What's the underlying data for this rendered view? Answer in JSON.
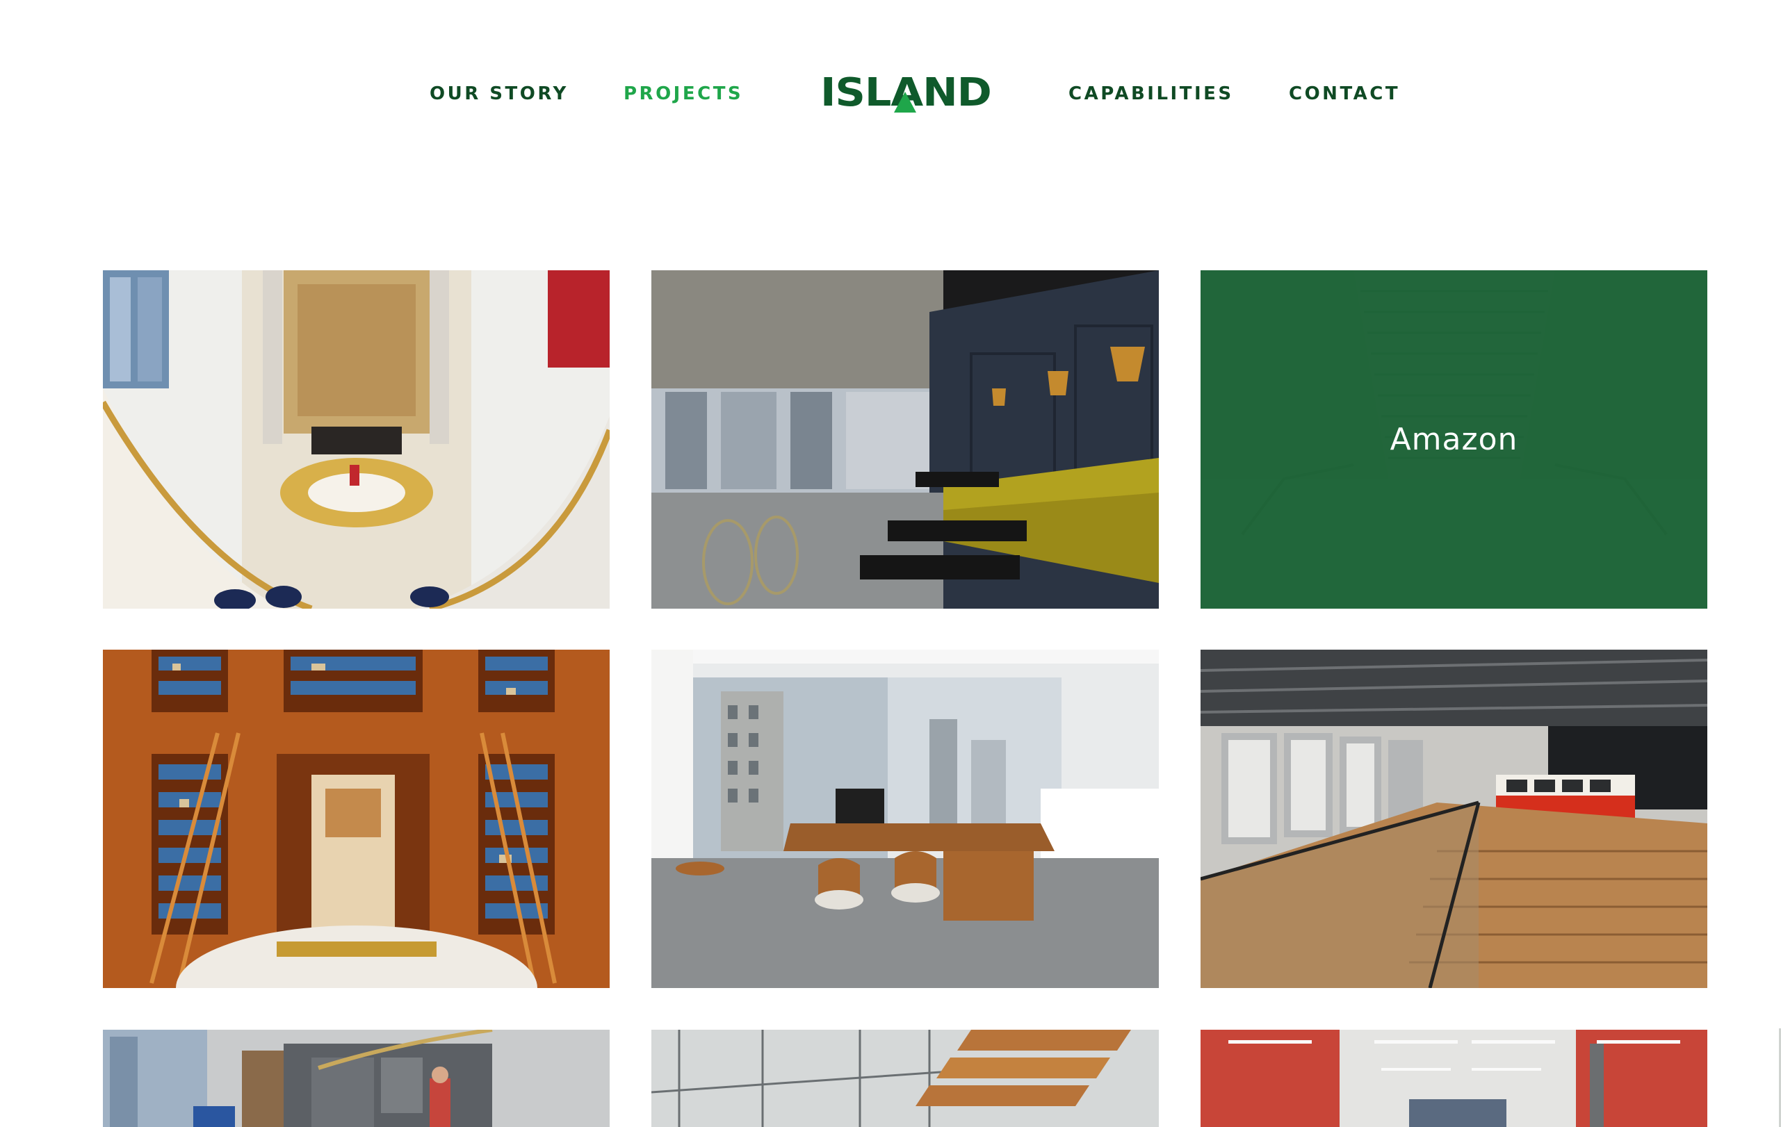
{
  "nav": {
    "left_items": [
      {
        "label": "OUR STORY",
        "active": false
      },
      {
        "label": "PROJECTS",
        "active": true
      }
    ],
    "logo_text": "ISLAND",
    "right_items": [
      {
        "label": "CAPABILITIES",
        "active": false
      },
      {
        "label": "CONTACT",
        "active": false
      }
    ]
  },
  "colors": {
    "brand_dark_green": "#0f4a24",
    "brand_green": "#1fa64a",
    "overlay_green": "#1e6437"
  },
  "projects": {
    "hovered_label": "Amazon"
  }
}
